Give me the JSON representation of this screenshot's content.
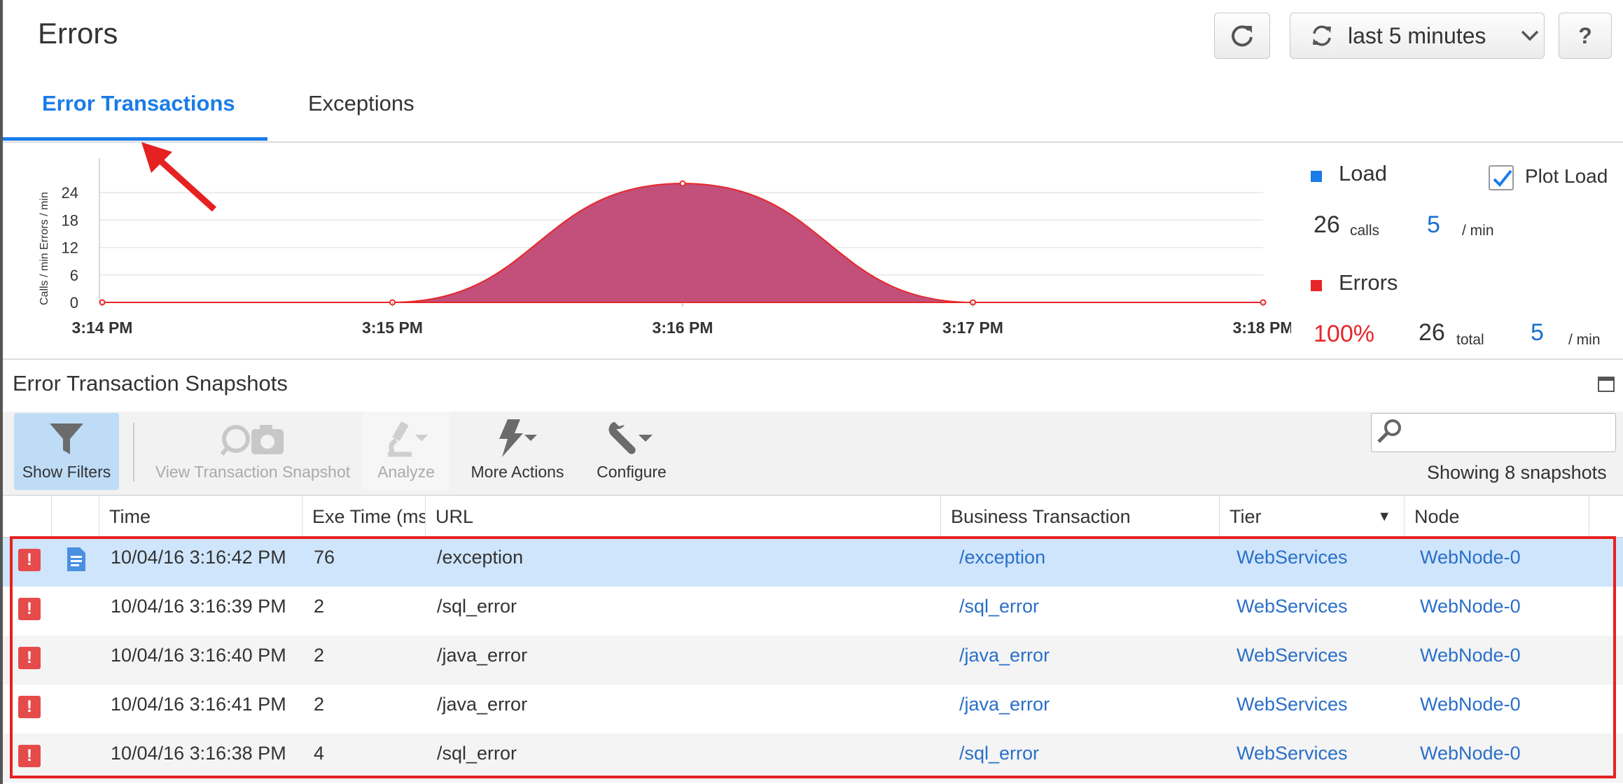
{
  "header": {
    "title": "Errors",
    "time_range": "last 5 minutes",
    "help_label": "?"
  },
  "tabs": [
    {
      "label": "Error Transactions",
      "active": true
    },
    {
      "label": "Exceptions",
      "active": false
    }
  ],
  "chart_data": {
    "type": "area",
    "ylabel": "Calls / min  Errors / min",
    "y_ticks": [
      "0",
      "6",
      "12",
      "18",
      "24"
    ],
    "ylim": [
      0,
      30
    ],
    "x": [
      "3:14 PM",
      "3:15 PM",
      "3:16 PM",
      "3:17 PM",
      "3:18 PM"
    ],
    "series": [
      {
        "name": "Errors",
        "values": [
          0,
          0,
          26,
          0,
          0
        ],
        "color": "#c2507a",
        "line_color": "#e8262a"
      }
    ],
    "grid": true
  },
  "legend": {
    "load_label": "Load",
    "load_color": "#1a7ce8",
    "plot_load_label": "Plot Load",
    "plot_load_checked": true,
    "load_calls": "26",
    "load_calls_unit": "calls",
    "load_rate": "5",
    "load_rate_unit": "/ min",
    "errors_label": "Errors",
    "errors_color": "#e8262a",
    "errors_pct": "100%",
    "errors_total": "26",
    "errors_total_unit": "total",
    "errors_rate": "5",
    "errors_rate_unit": "/ min"
  },
  "snapshots": {
    "title": "Error Transaction Snapshots",
    "toolbar": {
      "show_filters": "Show Filters",
      "view_snapshot": "View Transaction Snapshot",
      "analyze": "Analyze",
      "more_actions": "More Actions",
      "configure": "Configure"
    },
    "showing": "Showing 8 snapshots",
    "columns": [
      "Time",
      "Exe Time (ms",
      "URL",
      "Business Transaction",
      "Tier",
      "Node"
    ],
    "rows": [
      {
        "time": "10/04/16 3:16:42 PM",
        "exe": "76",
        "url": "/exception",
        "bt": "/exception",
        "tier": "WebServices",
        "node": "WebNode-0",
        "selected": true,
        "has_doc": true
      },
      {
        "time": "10/04/16 3:16:39 PM",
        "exe": "2",
        "url": "/sql_error",
        "bt": "/sql_error",
        "tier": "WebServices",
        "node": "WebNode-0",
        "selected": false,
        "has_doc": false
      },
      {
        "time": "10/04/16 3:16:40 PM",
        "exe": "2",
        "url": "/java_error",
        "bt": "/java_error",
        "tier": "WebServices",
        "node": "WebNode-0",
        "selected": false,
        "has_doc": false
      },
      {
        "time": "10/04/16 3:16:41 PM",
        "exe": "2",
        "url": "/java_error",
        "bt": "/java_error",
        "tier": "WebServices",
        "node": "WebNode-0",
        "selected": false,
        "has_doc": false
      },
      {
        "time": "10/04/16 3:16:38 PM",
        "exe": "4",
        "url": "/sql_error",
        "bt": "/sql_error",
        "tier": "WebServices",
        "node": "WebNode-0",
        "selected": false,
        "has_doc": false
      }
    ]
  }
}
